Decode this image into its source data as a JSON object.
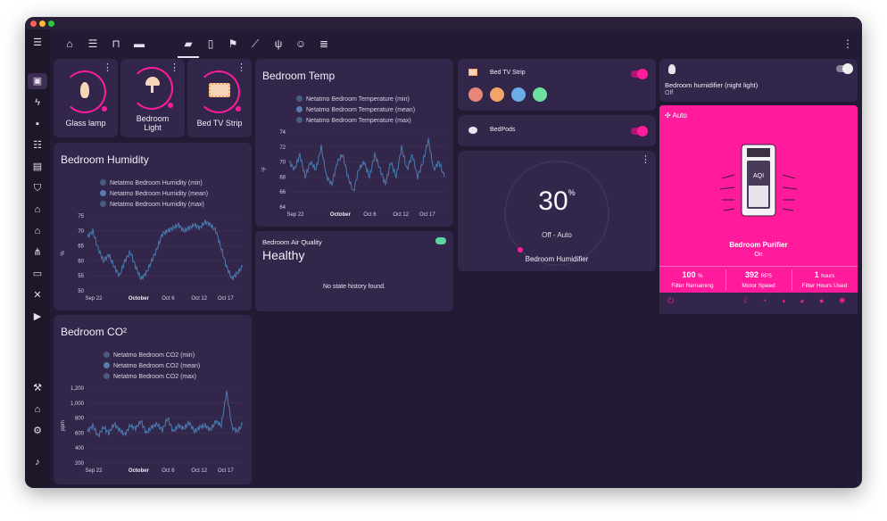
{
  "colors": {
    "accent": "#ff1b9c",
    "card": "#32274a",
    "bg": "#231a33",
    "line": "#4a7bb0"
  },
  "sidebar": {
    "icons": [
      "overview-icon",
      "lightning-icon",
      "account-box-icon",
      "list-icon",
      "chart-box-icon",
      "shield-icon",
      "storefront-icon",
      "home-icon",
      "sitemap-icon",
      "console-icon",
      "vscode-icon",
      "media-icon",
      "hammer-icon",
      "home-automation-icon",
      "settings-icon",
      "bell-icon"
    ]
  },
  "tabs": {
    "icons": [
      "home-assistant-icon",
      "server-icon",
      "lock-icon",
      "sofa-icon",
      "bed-icon",
      "fridge-icon",
      "flag-icon",
      "chart-line-icon",
      "silverware-icon",
      "robot-icon",
      "database-icon"
    ]
  },
  "tiles": [
    {
      "name": "Glass lamp"
    },
    {
      "name": "Bedroom Light"
    },
    {
      "name": "Bed TV Strip"
    }
  ],
  "humidity": {
    "title": "Bedroom Humidity",
    "legend": [
      "Netatmo Bedroom Humidity (min)",
      "Netatmo Bedroom Humidity (mean)",
      "Netatmo Bedroom Humidity (max)"
    ],
    "unit": "%"
  },
  "co2": {
    "title": "Bedroom CO²",
    "legend": [
      "Netatmo Bedroom CO2 (min)",
      "Netatmo Bedroom CO2 (mean)",
      "Netatmo Bedroom CO2 (max)"
    ],
    "unit": "ppm"
  },
  "temp": {
    "title": "Bedroom Temp",
    "legend": [
      "Netatmo Bedroom Temperature (min)",
      "Netatmo Bedroom Temperature (mean)",
      "Netatmo Bedroom Temperature (max)"
    ],
    "unit": "°F"
  },
  "air": {
    "label": "Bedroom Air Quality",
    "state": "Healthy",
    "history": "No state history found."
  },
  "tv_strip": {
    "name": "Bed TV Strip",
    "colors": [
      "#e9867a",
      "#f2a46a",
      "#6aaee8",
      "#6ee0a0"
    ]
  },
  "bedpods": {
    "name": "BedPods"
  },
  "humidifier": {
    "value": "30",
    "unit": "%",
    "mode": "Off - Auto",
    "name": "Bedroom Humidifier"
  },
  "nightlight": {
    "name": "Bedroom humidifier (night light)",
    "state": "Off"
  },
  "purifier": {
    "mode": "Auto",
    "aqi": "AQI",
    "name": "Bedroom Purifier",
    "state": "On",
    "stats": [
      {
        "value": "100",
        "unit": "%",
        "label": "Filter Remaining"
      },
      {
        "value": "392",
        "unit": "RPS",
        "label": "Motor Speed"
      },
      {
        "value": "1",
        "unit": "hours",
        "label": "Filter Hours Used"
      }
    ],
    "mode_icons": [
      "power-icon",
      "sleep-icon",
      "speed-1-icon",
      "speed-2-icon",
      "speed-3-icon",
      "favorite-icon",
      "auto-icon"
    ]
  },
  "chart_data": [
    {
      "type": "line",
      "title": "Bedroom Humidity",
      "ylabel": "%",
      "ylim": [
        50,
        75
      ],
      "yticks": [
        50,
        55,
        60,
        65,
        70,
        75
      ],
      "xticks": [
        "Sep 22",
        "October",
        "Oct 6",
        "Oct 12",
        "Oct 17"
      ],
      "series": [
        {
          "name": "Netatmo Bedroom Humidity (mean)",
          "values": [
            68,
            70,
            64,
            60,
            62,
            58,
            55,
            60,
            63,
            58,
            54,
            56,
            60,
            64,
            69,
            70,
            71,
            72,
            70,
            71,
            72,
            71,
            73,
            72,
            70,
            64,
            58,
            54,
            56,
            58
          ]
        }
      ]
    },
    {
      "type": "line",
      "title": "Bedroom CO²",
      "ylabel": "ppm",
      "ylim": [
        200,
        1200
      ],
      "yticks": [
        200,
        400,
        600,
        800,
        1000,
        1200
      ],
      "xticks": [
        "Sep 22",
        "October",
        "Oct 6",
        "Oct 12",
        "Oct 17"
      ],
      "series": [
        {
          "name": "Netatmo Bedroom CO2 (mean)",
          "values": [
            620,
            700,
            560,
            680,
            600,
            720,
            640,
            580,
            700,
            660,
            760,
            600,
            680,
            720,
            640,
            800,
            620,
            700,
            660,
            740,
            620,
            680,
            700,
            640,
            760,
            700,
            1150,
            680,
            620,
            720
          ]
        }
      ]
    },
    {
      "type": "line",
      "title": "Bedroom Temp",
      "ylabel": "°F",
      "ylim": [
        64,
        74
      ],
      "yticks": [
        64,
        66,
        68,
        70,
        72,
        74
      ],
      "xticks": [
        "Sep 22",
        "October",
        "Oct 6",
        "Oct 12",
        "Oct 17"
      ],
      "series": [
        {
          "name": "Netatmo Bedroom Temperature (mean)",
          "values": [
            70,
            69,
            71,
            68,
            70,
            69,
            72,
            68,
            67,
            70,
            71,
            68,
            66,
            69,
            70,
            68,
            71,
            69,
            67,
            70,
            68,
            72,
            69,
            71,
            68,
            70,
            73,
            69,
            70,
            68
          ]
        }
      ]
    }
  ]
}
